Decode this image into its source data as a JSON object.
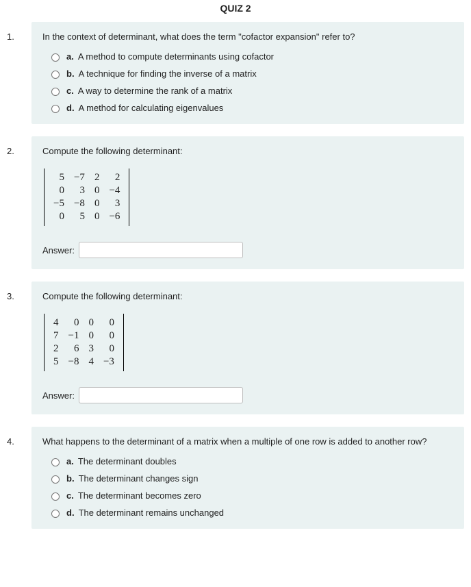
{
  "title": "QUIZ 2",
  "questions": [
    {
      "number": "1.",
      "prompt": "In the context of determinant, what does the term \"cofactor expansion\" refer to?",
      "type": "mc",
      "options": [
        {
          "letter": "a.",
          "text": "A method to compute determinants using cofactor"
        },
        {
          "letter": "b.",
          "text": "A technique for finding the inverse of a matrix"
        },
        {
          "letter": "c.",
          "text": "A way to determine the rank of a matrix"
        },
        {
          "letter": "d.",
          "text": "A method for calculating eigenvalues"
        }
      ]
    },
    {
      "number": "2.",
      "prompt": "Compute the following determinant:",
      "type": "matrix",
      "matrix": [
        [
          "5",
          "−7",
          "2",
          "2"
        ],
        [
          "0",
          "3",
          "0",
          "−4"
        ],
        [
          "−5",
          "−8",
          "0",
          "3"
        ],
        [
          "0",
          "5",
          "0",
          "−6"
        ]
      ],
      "answer_label": "Answer:"
    },
    {
      "number": "3.",
      "prompt": "Compute the following determinant:",
      "type": "matrix",
      "matrix": [
        [
          "4",
          "0",
          "0",
          "0"
        ],
        [
          "7",
          "−1",
          "0",
          "0"
        ],
        [
          "2",
          "6",
          "3",
          "0"
        ],
        [
          "5",
          "−8",
          "4",
          "−3"
        ]
      ],
      "answer_label": "Answer:"
    },
    {
      "number": "4.",
      "prompt": "What happens to the determinant of a matrix when a multiple of one row is added to another row?",
      "type": "mc",
      "options": [
        {
          "letter": "a.",
          "text": "The determinant doubles"
        },
        {
          "letter": "b.",
          "text": "The determinant changes sign"
        },
        {
          "letter": "c.",
          "text": "The determinant becomes zero"
        },
        {
          "letter": "d.",
          "text": "The determinant remains unchanged"
        }
      ]
    }
  ]
}
